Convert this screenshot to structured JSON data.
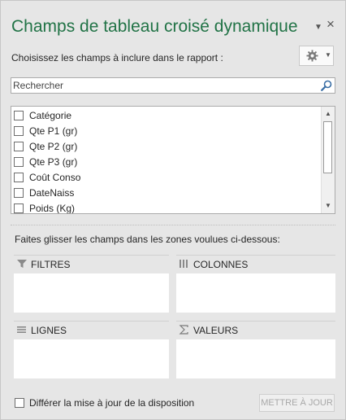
{
  "panel": {
    "title": "Champs de tableau croisé dynamique",
    "dropdown_icon": "triangle-down-icon",
    "close_icon": "close-icon",
    "subtitle": "Choisissez les champs à inclure dans le rapport :",
    "tools_icon": "gear-icon"
  },
  "search": {
    "placeholder": "Rechercher",
    "value": "",
    "icon": "magnifier-icon"
  },
  "fields": [
    {
      "label": "Catégorie",
      "checked": false
    },
    {
      "label": "Qte P1 (gr)",
      "checked": false
    },
    {
      "label": "Qte P2 (gr)",
      "checked": false
    },
    {
      "label": "Qte P3 (gr)",
      "checked": false
    },
    {
      "label": "Coût Conso",
      "checked": false
    },
    {
      "label": "DateNaiss",
      "checked": false
    },
    {
      "label": "Poids (Kg)",
      "checked": false
    }
  ],
  "areas": {
    "hint": "Faites glisser les champs dans les zones voulues ci-dessous:",
    "filters": {
      "label": "FILTRES",
      "icon": "filter-icon"
    },
    "columns": {
      "label": "COLONNES",
      "icon": "columns-icon"
    },
    "rows": {
      "label": "LIGNES",
      "icon": "rows-icon"
    },
    "values": {
      "label": "VALEURS",
      "icon": "sigma-icon"
    }
  },
  "footer": {
    "defer_label": "Différer la mise à jour de la disposition",
    "defer_checked": false,
    "update_button": "METTRE À JOUR"
  },
  "colors": {
    "title": "#217346",
    "background": "#e6e6e6"
  }
}
